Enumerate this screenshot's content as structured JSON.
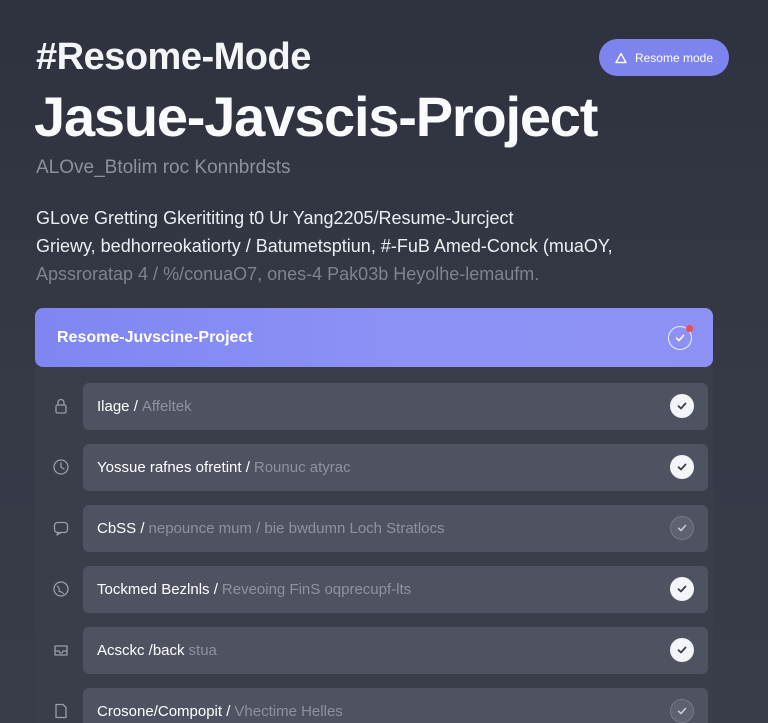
{
  "header": {
    "tag_title": "#Resome-Mode",
    "mode_button_label": "Resome mode",
    "mode_button_icon": "triangle-warning-icon",
    "project_title": "Jasue-Javscis-Project",
    "subtitle": "ALOve_Btolim roc Konnbrdsts"
  },
  "description": {
    "lines": [
      "GLove Gretting Gkerititing t0 Ur Yang2205/Resume-Jurcject",
      "Griewy, bedhorreokatiorty / Batumetsptiun, #-FuB Amed-Conck (muaOY,"
    ],
    "faded_line": "Apssroratap 4 / %/conuaO7, ones-4 Pak03b Heyolhe-lemaufm."
  },
  "active_item": {
    "label": "Resome-Juvscine-Project",
    "status_icon": "check-circle-icon",
    "notification_color": "#ef4d4d"
  },
  "items": [
    {
      "primary": "Ilage /",
      "secondary": "Affeltek",
      "side_icon": "lock-icon",
      "checked": true
    },
    {
      "primary": "Yossue rafnes ofretint /",
      "secondary": "Rounuc atyrac",
      "side_icon": "clock-icon",
      "checked": true
    },
    {
      "primary": "CbSS /",
      "secondary": "nepounce mum / bie bwdumn Loch Stratlocs",
      "side_icon": "chat-icon",
      "checked": false
    },
    {
      "primary": "Tockmed Bezlnls /",
      "secondary": "Reveoing FinS oqprecupf-lts",
      "side_icon": "globe-icon",
      "checked": true
    },
    {
      "primary": "Acsckc /back",
      "secondary": "stua",
      "side_icon": "inbox-icon",
      "checked": true
    },
    {
      "primary": "Crosone/Compopit /",
      "secondary": "Vhectime Helles",
      "side_icon": "file-icon",
      "checked": false
    }
  ],
  "colors": {
    "accent": "#7e84ee",
    "background": "#30343f",
    "row": "#4f5361"
  }
}
